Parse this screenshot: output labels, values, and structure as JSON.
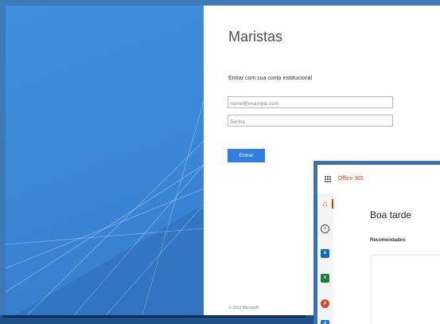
{
  "login": {
    "org_title": "Maristas",
    "signin_label": "Entrar com sua conta institucional",
    "username_placeholder": "nome@example.com",
    "password_placeholder": "Senha",
    "submit_label": "Entrar",
    "copyright": "© 2013 Microsoft"
  },
  "office": {
    "app_title": "Office 365",
    "greeting": "Boa tarde",
    "section_label": "Recomendados",
    "rail_icons": [
      "home-icon",
      "add-icon",
      "outlook-icon",
      "excel-icon",
      "powerpoint-icon",
      "onedrive-icon"
    ]
  },
  "colors": {
    "accent_blue": "#2f7ee0",
    "office_orange": "#d83b01",
    "panel_blue": "#3b86d6"
  }
}
